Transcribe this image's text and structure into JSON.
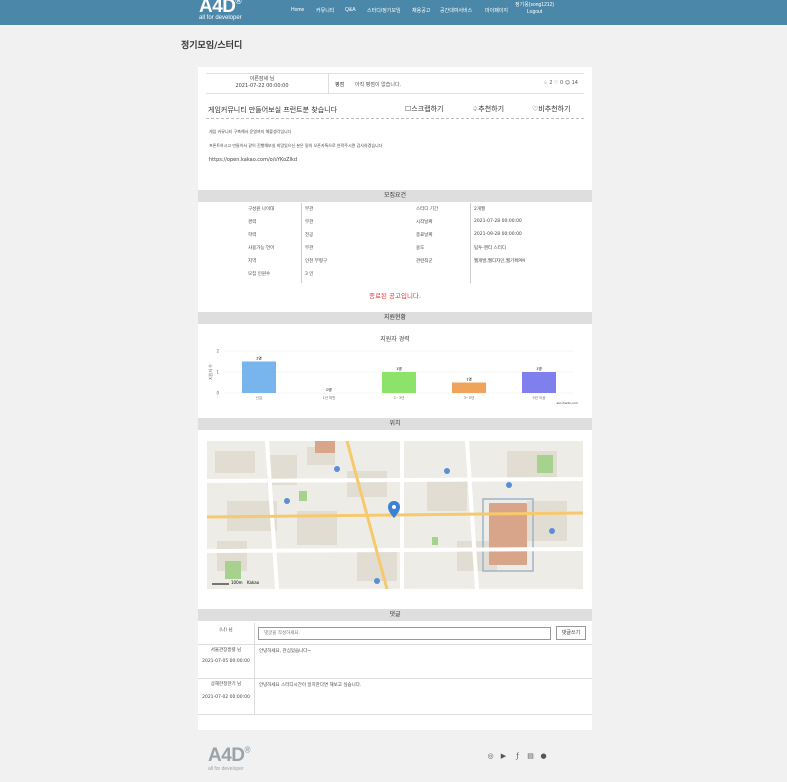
{
  "header": {
    "logo": "A4D",
    "logo_sup": "Ⓡ",
    "logo_sub": "all for developer",
    "nav": [
      "Home",
      "커뮤니티",
      "Q&A",
      "스터디/정기모임",
      "채용공고",
      "공간대여서비스",
      "마이페이지"
    ],
    "user_line1": "정기웅(song1212)",
    "user_line2": "Logout"
  },
  "page_title": "정기모임/스터디",
  "post": {
    "author": "이른잠세 님",
    "date": "2021-07-22 00:00:00",
    "grade_label": "평점",
    "grade_value": "아직 평점이 없습니다.",
    "stats": "♤ 2 ♡ 0 ☺ 14",
    "title": "게임커뮤니티 만들어보실 프런트분 찾습니다",
    "actions": [
      "☐스크랩하기",
      "♤추천하기",
      "♡비추천하기"
    ],
    "body": [
      "게임 커뮤니티 구축해서 운영까지 해볼생각입니다",
      "프론트하시고 만들어서 같이 진행해보실 희망있으신 분은 밑의 오픈카톡으로 연락주시면 감사하겠습니다"
    ],
    "link": "https://open.kakao.com/o/sYKoZlkd"
  },
  "requirements": {
    "section": "모집요건",
    "rows": [
      [
        "구성원 나이대",
        "무관",
        "스터디 기간",
        "2개월"
      ],
      [
        "경력",
        "무관",
        "시작날짜",
        "2021-07-28 00:00:00"
      ],
      [
        "학력",
        "전공",
        "종료날짜",
        "2021-09-28 00:00:00"
      ],
      [
        "사용가능 언어",
        "무관",
        "용도",
        "팀투-멘티 스터디"
      ],
      [
        "지역",
        "인천 부평구",
        "관련직군",
        "웹개발,웹디자인,웹기획PM"
      ],
      [
        "모집 인원수",
        "3 인",
        "",
        ""
      ]
    ],
    "closed": "종료된 공고입니다."
  },
  "applicants": {
    "section": "지원현황",
    "chart_title": "지원자 경력",
    "credit": "amcharts.com"
  },
  "chart_data": {
    "type": "bar",
    "title": "지원자 경력",
    "categories": [
      "신입",
      "1년 미만",
      "1~3년",
      "3~5년",
      "5년 이상"
    ],
    "values": [
      1.5,
      0,
      1,
      0.5,
      1
    ],
    "labels": [
      "2명",
      "0명",
      "1명",
      "1명",
      "1명"
    ],
    "colors": [
      "#78b5ec",
      "#aaaaaa",
      "#8ce36a",
      "#f0a35a",
      "#7f7fee"
    ],
    "ylim": [
      0,
      2
    ],
    "yticks": [
      "0",
      "1",
      "2"
    ],
    "ylabel": "지원자 수"
  },
  "location": {
    "section": "위치",
    "scale": "100m",
    "credit": "Kakao"
  },
  "comments": {
    "section": "댓글",
    "me": "(나) 님",
    "placeholder": "댓글을 작성하세요.",
    "button": "댓글쓰기",
    "items": [
      {
        "name": "서울관장흥렬 님",
        "date": "2021-07-05 00:00:00",
        "text": "안녕하세요, 관심있습니다~"
      },
      {
        "name": "상해한정한기 님",
        "date": "2021-07-02 00:00:00",
        "text": "안녕하세요 스터디시간이 일치한다면 해보고 싶습니다."
      }
    ]
  },
  "footer": {
    "logo": "A4D",
    "logo_sup": "Ⓡ",
    "logo_sub": "all for developer",
    "sns": [
      "instagram-icon",
      "youtube-icon",
      "facebook-icon",
      "blog-icon",
      "talk-icon"
    ]
  }
}
